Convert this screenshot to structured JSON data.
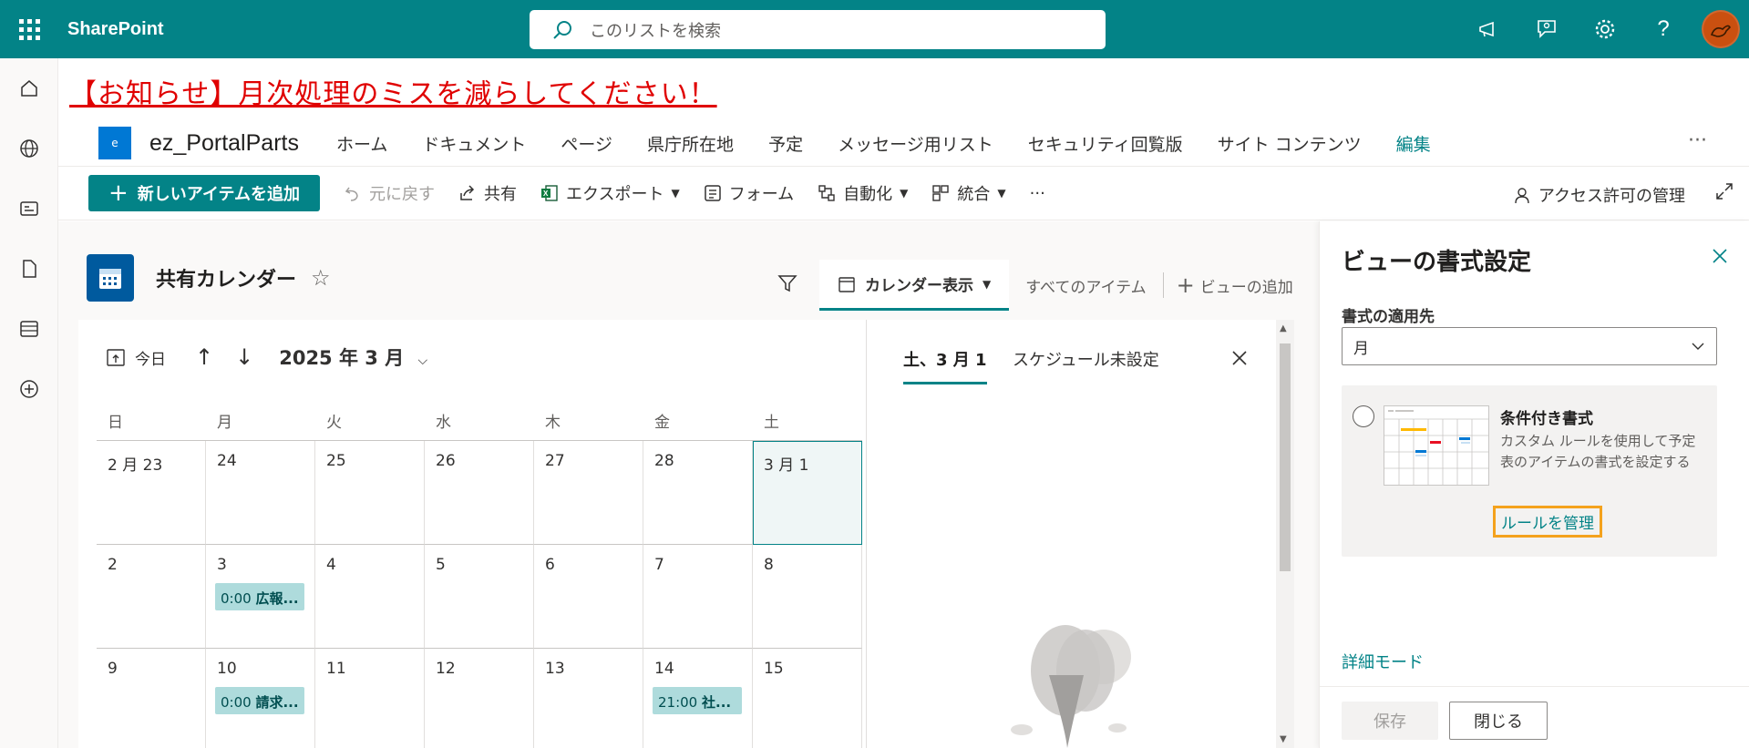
{
  "suite": {
    "brand": "SharePoint",
    "search_placeholder": "このリストを検索"
  },
  "announcement": "【お知らせ】月次処理のミスを減らしてください！",
  "site": {
    "logo_letter": "e",
    "name": "ez_PortalParts",
    "nav": [
      "ホーム",
      "ドキュメント",
      "ページ",
      "県庁所在地",
      "予定",
      "メッセージ用リスト",
      "セキュリティ回覧版",
      "サイト コンテンツ"
    ],
    "edit_label": "編集",
    "more": "···"
  },
  "commands": {
    "new_item": "新しいアイテムを追加",
    "undo": "元に戻す",
    "share": "共有",
    "export": "エクスポート",
    "forms": "フォーム",
    "automate": "自動化",
    "integrate": "統合",
    "more": "···",
    "access": "アクセス許可の管理"
  },
  "list": {
    "title": "共有カレンダー",
    "view_active": "カレンダー表示",
    "view_all": "すべてのアイテム",
    "view_add": "ビューの追加"
  },
  "calendar": {
    "today": "今日",
    "month_label": "2025 年 3 月",
    "weekdays": [
      "日",
      "月",
      "火",
      "水",
      "木",
      "金",
      "土"
    ],
    "weeks": [
      [
        "2 月 23",
        "24",
        "25",
        "26",
        "27",
        "28",
        "3 月 1"
      ],
      [
        "2",
        "3",
        "4",
        "5",
        "6",
        "7",
        "8"
      ],
      [
        "9",
        "10",
        "11",
        "12",
        "13",
        "14",
        "15"
      ]
    ],
    "events": {
      "w1_mon_time": "0:00",
      "w1_mon_title": "広報...",
      "w2_mon_time": "0:00",
      "w2_mon_title": "請求...",
      "w2_fri_time": "21:00",
      "w2_fri_title": "社..."
    }
  },
  "daypane": {
    "date_label": "土、3 月 1",
    "status": "スケジュール未設定"
  },
  "format_pane": {
    "title": "ビューの書式設定",
    "apply_label": "書式の適用先",
    "apply_value": "月",
    "card_title": "条件付き書式",
    "card_desc": "カスタム ルールを使用して予定表のアイテムの書式を設定する",
    "manage_rules": "ルールを管理",
    "advanced": "詳細モード",
    "save": "保存",
    "close": "閉じる"
  },
  "colors": {
    "theme": "#038387",
    "announcement": "#e00000",
    "event_bg": "#aedbdc",
    "highlight": "#f4a21d"
  }
}
